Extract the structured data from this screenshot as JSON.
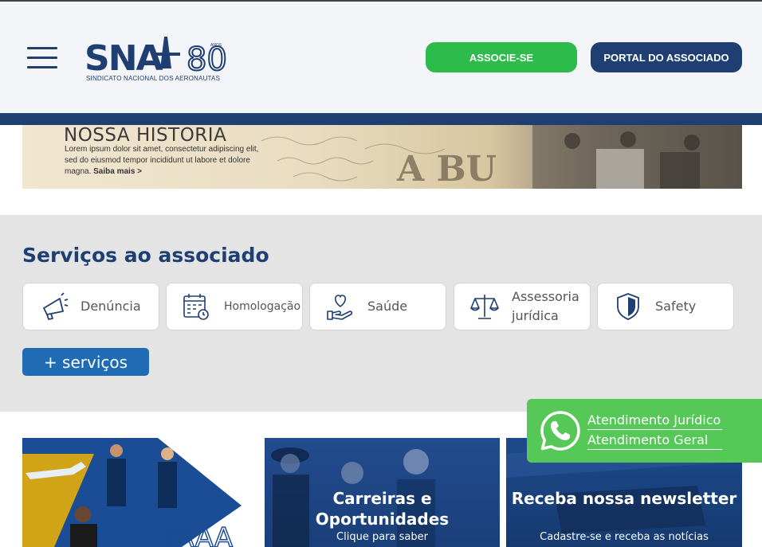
{
  "header": {
    "logo_text": "SNA",
    "logo_anniversary": "80",
    "logo_anos": "ANOS",
    "logo_subtitle": "SINDICATO NACIONAL DOS AERONAUTAS",
    "associe_label": "ASSOCIE-SE",
    "portal_label": "PORTAL DO ASSOCIADO"
  },
  "history_banner": {
    "title": "NOSSA HISTORIA",
    "text": "Lorem ipsum dolor sit amet, consectetur adipiscing elit, sed do eiusmod tempor incididunt ut labore et dolore magna.",
    "link": "Saiba mais >"
  },
  "services": {
    "title": "Serviços ao associado",
    "items": [
      {
        "label": "Denúncia",
        "icon": "megaphone-icon"
      },
      {
        "label": "Homologação",
        "icon": "calendar-clock-icon"
      },
      {
        "label": "Saúde",
        "icon": "heart-hand-icon"
      },
      {
        "label": "Assessoria jurídica",
        "icon": "scales-icon"
      },
      {
        "label": "Safety",
        "icon": "shield-icon"
      }
    ],
    "more_label": "+ serviços"
  },
  "promos": [
    {
      "title": "",
      "subtitle": "",
      "logo_text": "FAAA"
    },
    {
      "title": "Carreiras e Oportunidades",
      "subtitle": "Clique para saber"
    },
    {
      "title": "Receba nossa newsletter",
      "subtitle": "Cadastre-se e receba as notícias"
    }
  ],
  "whatsapp": {
    "icon": "whatsapp-icon",
    "links": [
      "Atendimento Jurídico",
      "Atendimento Geral"
    ]
  },
  "colors": {
    "brand_blue": "#1f3f73",
    "green": "#2dbb4b",
    "whatsapp_green": "#56c857",
    "services_bg": "#e4e4e4",
    "more_button": "#1f6cb4"
  }
}
